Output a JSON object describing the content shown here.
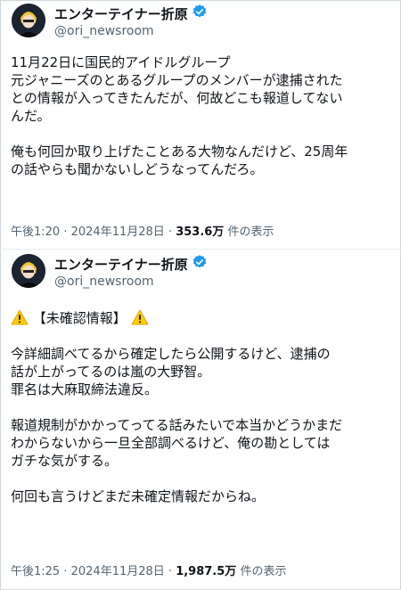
{
  "tweets": [
    {
      "display_name": "エンターテイナー折原",
      "handle": "@ori_newsroom",
      "verified": true,
      "body_lines": [
        "11月22日に国民的アイドルグループ",
        "元ジャニーズのとあるグループのメンバーが逮捕された",
        "との情報が入ってきたんだが、何故どこも報道してない",
        "んだ。",
        "",
        "俺も何回か取り上げたことある大物なんだけど、25周年",
        "の話やらも聞かないしどうなってんだろ。"
      ],
      "time": "午後1:20",
      "date": "2024年11月28日",
      "views_count": "353.6万",
      "views_label": "件の表示"
    },
    {
      "display_name": "エンターテイナー折原",
      "handle": "@ori_newsroom",
      "verified": true,
      "headline": "【未確認情報】",
      "headline_icon": "warning-icon",
      "body_lines": [
        "",
        "今詳細調べてるから確定したら公開するけど、逮捕の",
        "話が上がってるのは嵐の大野智。",
        "罪名は大麻取締法違反。",
        "",
        "報道規制がかかってってる話みたいで本当かどうかまだ",
        "わからないから一旦全部調べるけど、俺の勘としては",
        "ガチな気がする。",
        "",
        "何回も言うけどまだ未確定情報だからね。"
      ],
      "time": "午後1:25",
      "date": "2024年11月28日",
      "views_count": "1,987.5万",
      "views_label": "件の表示"
    }
  ],
  "separator": " · ",
  "colors": {
    "text": "#0f1419",
    "secondary": "#536471",
    "verified": "#1d9bf0",
    "warning": "#ffcc00",
    "border": "#cfd9de"
  }
}
